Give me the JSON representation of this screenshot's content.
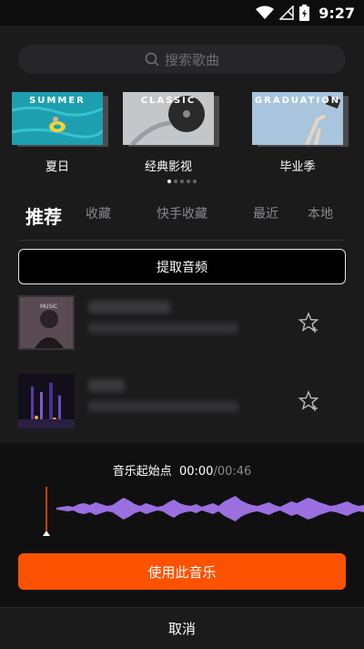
{
  "status_bar": {
    "time": "9:27",
    "icons": [
      "wifi-icon",
      "signal-icon",
      "battery-charging-icon"
    ]
  },
  "search": {
    "placeholder": "搜索歌曲",
    "icon": "search-icon"
  },
  "categories": [
    {
      "tag": "SUMMER",
      "label": "夏日"
    },
    {
      "tag": "CLASSIC",
      "label": "经典影视"
    },
    {
      "tag": "GRADUATION",
      "label": "毕业季"
    }
  ],
  "carousel": {
    "pages": 5,
    "active": 1
  },
  "tabs": [
    "推荐",
    "收藏",
    "快手收藏",
    "最近",
    "本地"
  ],
  "active_tab": "推荐",
  "extract_audio_label": "提取音频",
  "songs": [
    {
      "cover_text": "MUSIC"
    },
    {
      "cover_text": ""
    }
  ],
  "player": {
    "start_label": "音乐起始点",
    "current_time": "00:00",
    "separator": "/",
    "total_time": "00:46",
    "accent": "#fd5202",
    "wave_color": "#9b6fe0"
  },
  "use_music_label": "使用此音乐",
  "cancel_label": "取消"
}
